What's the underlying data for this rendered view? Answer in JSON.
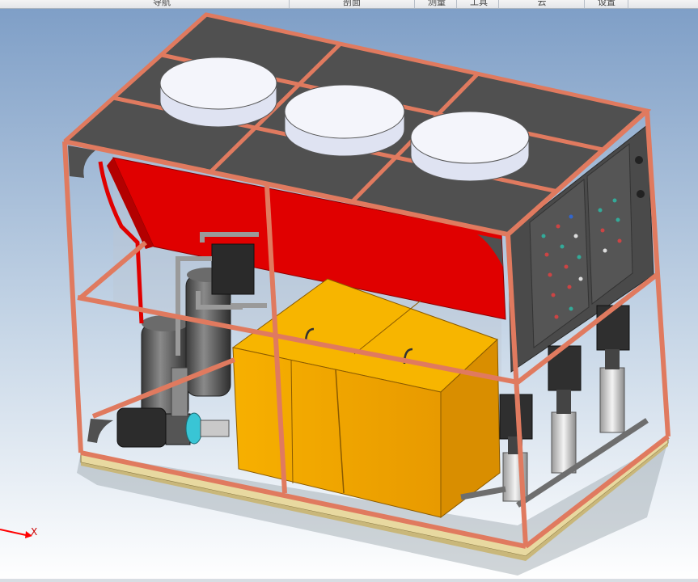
{
  "menubar": {
    "items": [
      {
        "label": "导航"
      },
      {
        "label": "剖面"
      },
      {
        "label": "测量"
      },
      {
        "label": "工具"
      },
      {
        "label": "云"
      },
      {
        "label": "设置"
      }
    ]
  },
  "viewport": {
    "axis_label": "X",
    "colors": {
      "background_top": "#7f9fc7",
      "background_bottom": "#ffffff",
      "frame": "#e07a5f",
      "panel": "#4d4d4d",
      "coil": "#e00000",
      "tank": "#f5a800",
      "fan": "#f2f2f2",
      "pump": "#cccccc",
      "axis": "#ff0000"
    },
    "icons": [
      "fan-icon",
      "pump-icon",
      "compressor-icon",
      "axis-triad-icon"
    ]
  }
}
